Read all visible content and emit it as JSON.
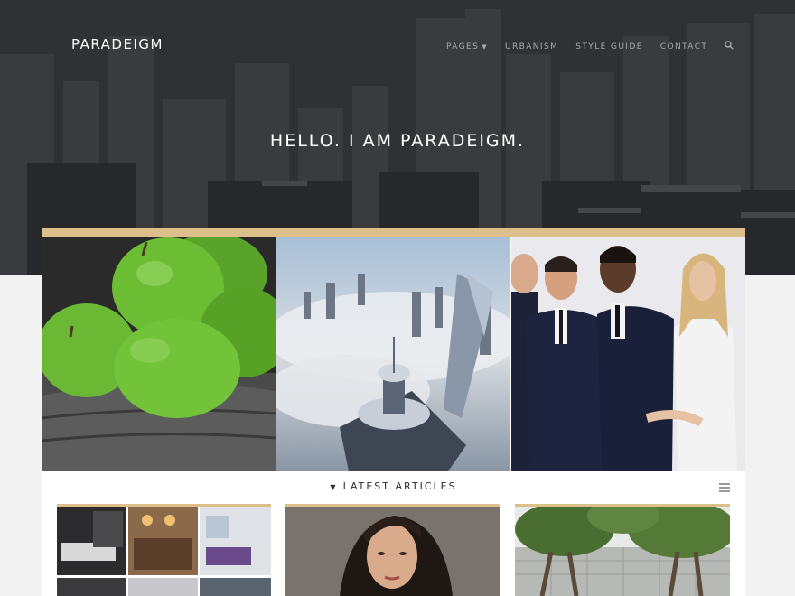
{
  "brand": {
    "logo": "PARADEIGM"
  },
  "nav": {
    "items": [
      {
        "label": "PAGES",
        "has_dropdown": true
      },
      {
        "label": "URBANISM"
      },
      {
        "label": "STYLE GUIDE"
      },
      {
        "label": "CONTACT"
      }
    ],
    "search_icon": "search-icon"
  },
  "hero": {
    "title": "HELLO. I AM PARADEIGM."
  },
  "articles": {
    "heading": "LATEST ARTICLES",
    "menu_icon": "hamburger-icon",
    "heading_icon": "caret-down-icon"
  },
  "colors": {
    "accent": "#dcbf8a",
    "hero_bg": "#2f3033",
    "nav_text": "#a9aaad",
    "page_bg": "#f2f2f2"
  }
}
